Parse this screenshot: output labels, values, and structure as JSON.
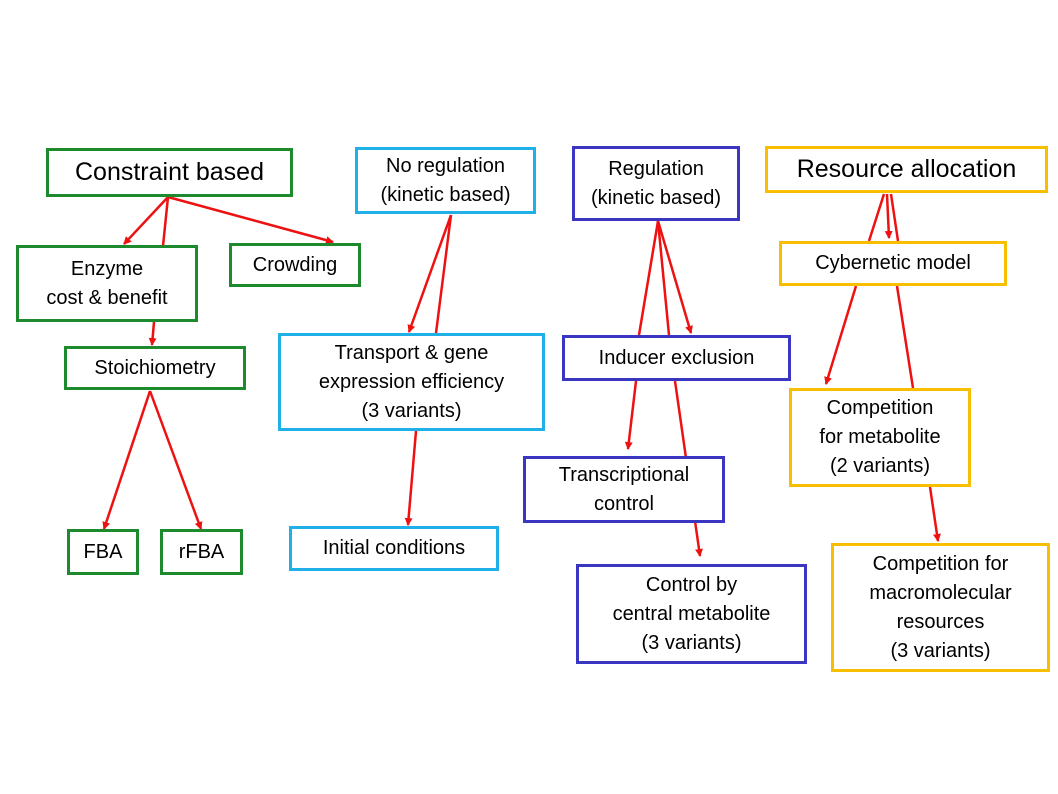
{
  "colors": {
    "constraint": "#1e8a2e",
    "no_regulation": "#1eb0e6",
    "regulation": "#3b36c2",
    "resource": "#f7bf00",
    "arrow": "#ee1111"
  },
  "nodes": {
    "constraint": "Constraint based",
    "enzyme": "Enzyme\ncost & benefit",
    "crowding": "Crowding",
    "stoich": "Stoichiometry",
    "fba": "FBA",
    "rfba": "rFBA",
    "noreg": "No regulation\n(kinetic based)",
    "transport": "Transport & gene\nexpression efficiency\n(3 variants)",
    "initial": "Initial conditions",
    "reg": "Regulation\n(kinetic based)",
    "inducer": "Inducer exclusion",
    "transcr": "Transcriptional\ncontrol",
    "central": "Control by\ncentral metabolite\n(3 variants)",
    "resource": "Resource allocation",
    "cyber": "Cybernetic model",
    "compmet": "Competition\nfor metabolite\n(2 variants)",
    "compmacro": "Competition for\nmacromolecular\nresources\n(3 variants)"
  },
  "edges": [
    {
      "from": "constraint",
      "to": "enzyme"
    },
    {
      "from": "constraint",
      "to": "stoich"
    },
    {
      "from": "constraint",
      "to": "crowding"
    },
    {
      "from": "enzyme",
      "to": "stoich"
    },
    {
      "from": "stoich",
      "to": "fba"
    },
    {
      "from": "stoich",
      "to": "rfba"
    },
    {
      "from": "noreg",
      "to": "transport"
    },
    {
      "from": "noreg",
      "to": "initial"
    },
    {
      "from": "transport",
      "to": "initial"
    },
    {
      "from": "reg",
      "to": "inducer"
    },
    {
      "from": "reg",
      "to": "transcr"
    },
    {
      "from": "reg",
      "to": "central"
    },
    {
      "from": "inducer",
      "to": "transcr"
    },
    {
      "from": "inducer",
      "to": "central"
    },
    {
      "from": "resource",
      "to": "cyber"
    },
    {
      "from": "resource",
      "to": "compmet"
    },
    {
      "from": "resource",
      "to": "compmacro"
    },
    {
      "from": "cyber",
      "to": "compmet"
    },
    {
      "from": "cyber",
      "to": "compmacro"
    },
    {
      "from": "compmet",
      "to": "compmacro"
    }
  ]
}
